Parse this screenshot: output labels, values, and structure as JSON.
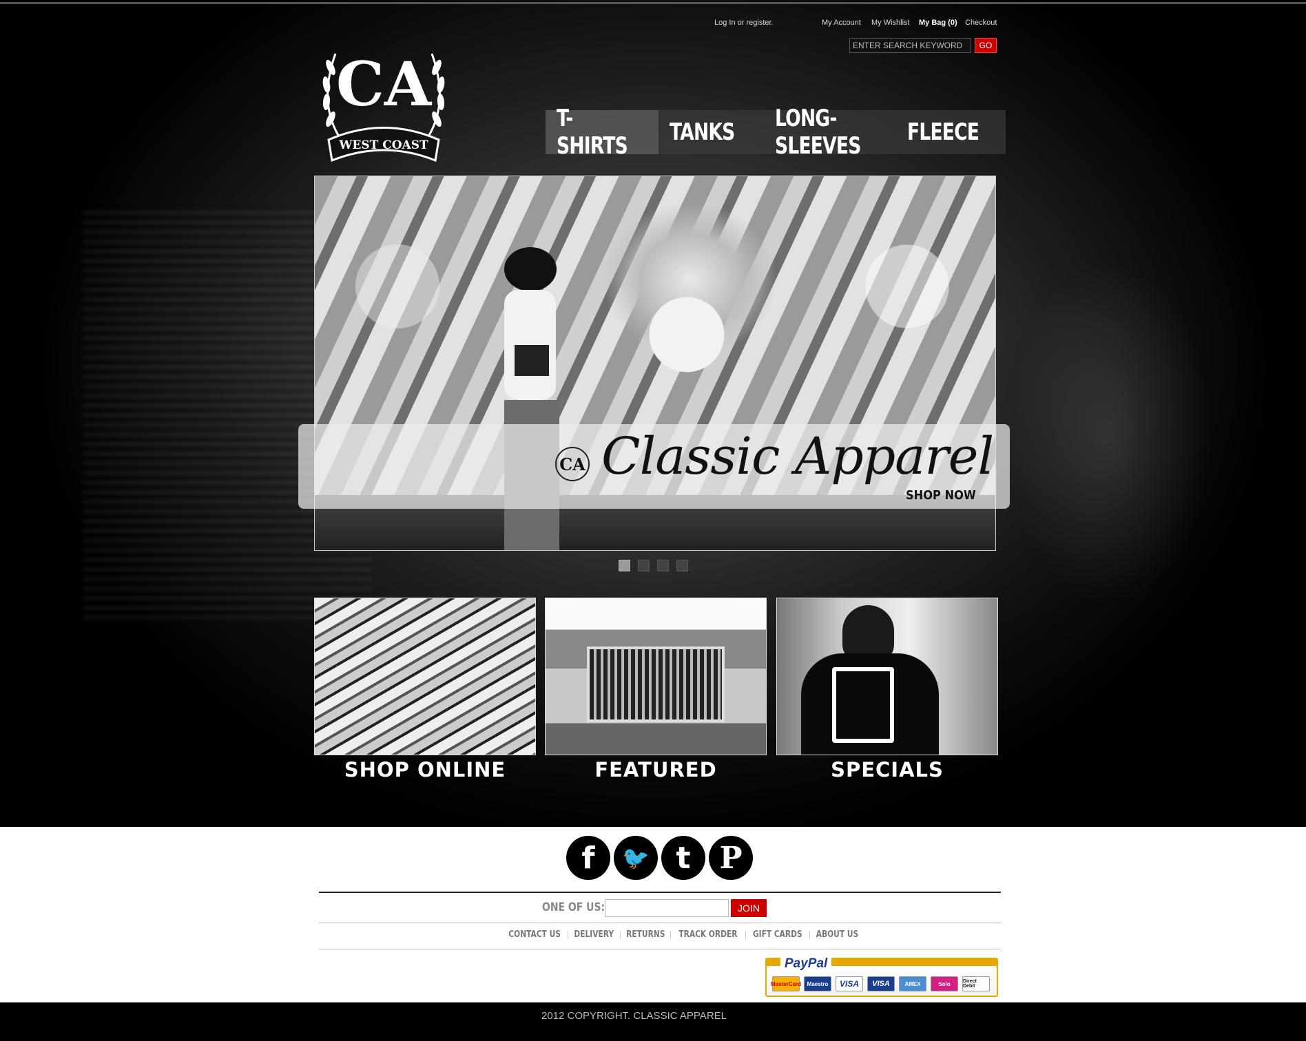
{
  "header": {
    "login_text": "Log In or register.",
    "links": {
      "account": "My Account",
      "wishlist": "My Wishlist",
      "bag": "My Bag (0)",
      "checkout": "Checkout"
    },
    "search": {
      "placeholder": "ENTER SEARCH KEYWORD",
      "button_label": "GO"
    },
    "logo": {
      "monogram": "CA",
      "banner": "WEST COAST"
    }
  },
  "nav": {
    "items": [
      {
        "label": "T-SHIRTS",
        "active": true
      },
      {
        "label": "TANKS",
        "active": false
      },
      {
        "label": "LONG-SLEEVES",
        "active": false
      },
      {
        "label": "FLEECE",
        "active": false
      }
    ]
  },
  "slider": {
    "caption_script": "Classic Apparel",
    "caption_cta": "SHOP NOW",
    "caption_monogram": "CA",
    "dots_count": 4,
    "active_dot": 1
  },
  "tiles": [
    {
      "label": "SHOP ONLINE"
    },
    {
      "label": "FEATURED"
    },
    {
      "label": "SPECIALS"
    }
  ],
  "social": [
    {
      "icon": "facebook-icon",
      "glyph": "f"
    },
    {
      "icon": "twitter-icon",
      "glyph": "🐦"
    },
    {
      "icon": "tumblr-icon",
      "glyph": "t"
    },
    {
      "icon": "pinterest-icon",
      "glyph": "P"
    }
  ],
  "newsletter": {
    "label": "ONE OF US:",
    "button_label": "JOIN"
  },
  "footer_links": [
    "CONTACT US",
    "DELIVERY",
    "RETURNS",
    "TRACK ORDER",
    "GIFT CARDS",
    "ABOUT US"
  ],
  "payments": {
    "brand": "PayPal",
    "cards": [
      "MasterCard",
      "Maestro",
      "VISA",
      "VISA",
      "AMEX",
      "Solo",
      "Direct Debit"
    ]
  },
  "copyright": "2012 COPYRIGHT.  CLASSIC APPAREL",
  "colors": {
    "accent_red": "#cc0000",
    "paypal_gold": "#e6a800",
    "paypal_blue": "#1a3d8f"
  }
}
